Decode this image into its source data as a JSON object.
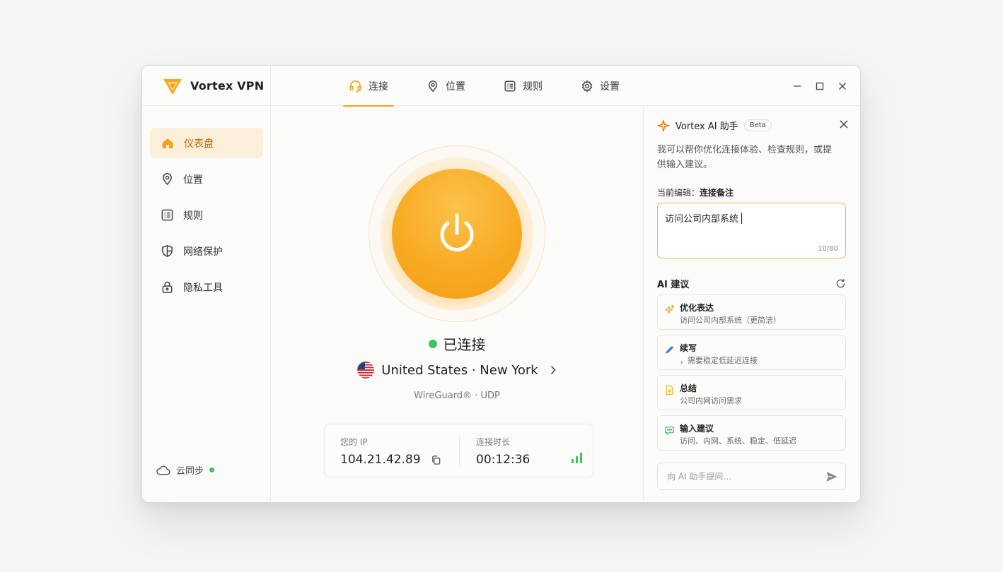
{
  "app": {
    "name": "Vortex VPN",
    "accent_color": "#f3a11b"
  },
  "topnav": {
    "items": [
      {
        "label": "连接",
        "icon": "headset-icon",
        "active": true
      },
      {
        "label": "位置",
        "icon": "location-pin-icon",
        "active": false
      },
      {
        "label": "规则",
        "icon": "rules-list-icon",
        "active": false
      },
      {
        "label": "设置",
        "icon": "gear-icon",
        "active": false
      }
    ]
  },
  "window_controls": [
    "minimize-icon",
    "maximize-icon",
    "close-icon"
  ],
  "sidebar": {
    "items": [
      {
        "label": "仪表盘",
        "icon": "home-icon",
        "active": true
      },
      {
        "label": "位置",
        "icon": "location-pin-icon",
        "active": false
      },
      {
        "label": "规则",
        "icon": "rules-list-icon",
        "active": false
      },
      {
        "label": "网络保护",
        "icon": "shield-icon",
        "active": false
      },
      {
        "label": "隐私工具",
        "icon": "lock-icon",
        "active": false
      }
    ],
    "cloud_sync": {
      "label": "云同步",
      "status_color": "#3cc35c"
    }
  },
  "main": {
    "status": "已连接",
    "status_color": "#3cc35c",
    "location": "United States · New York",
    "protocol": "WireGuard® · UDP",
    "ip_label": "您的 IP",
    "ip_value": "104.21.42.89",
    "duration_label": "连接时长",
    "duration_value": "00:12:36"
  },
  "ai_panel": {
    "title": "Vortex AI 助手",
    "badge": "Beta",
    "description": "我可以帮你优化连接体验、检查规则，或提供输入建议。",
    "edit_label": "当前编辑：",
    "edit_target": "连接备注",
    "edit_value": "访问公司内部系统",
    "counter": "10/80",
    "suggestions_title": "AI 建议",
    "suggestions": [
      {
        "title": "优化表达",
        "text": "访问公司内部系统（更简洁）",
        "icon": "sparkle-icon",
        "color": "#f3a11b"
      },
      {
        "title": "续写",
        "text": "，需要稳定低延迟连接",
        "icon": "pencil-icon",
        "color": "#3b7be0"
      },
      {
        "title": "总结",
        "text": "公司内网访问需求",
        "icon": "document-icon",
        "color": "#f0b429"
      },
      {
        "title": "输入建议",
        "text": "访问、内网、系统、稳定、低延迟",
        "icon": "chat-icon",
        "color": "#3cc35c"
      }
    ],
    "ask_placeholder": "向 AI 助手提问..."
  }
}
